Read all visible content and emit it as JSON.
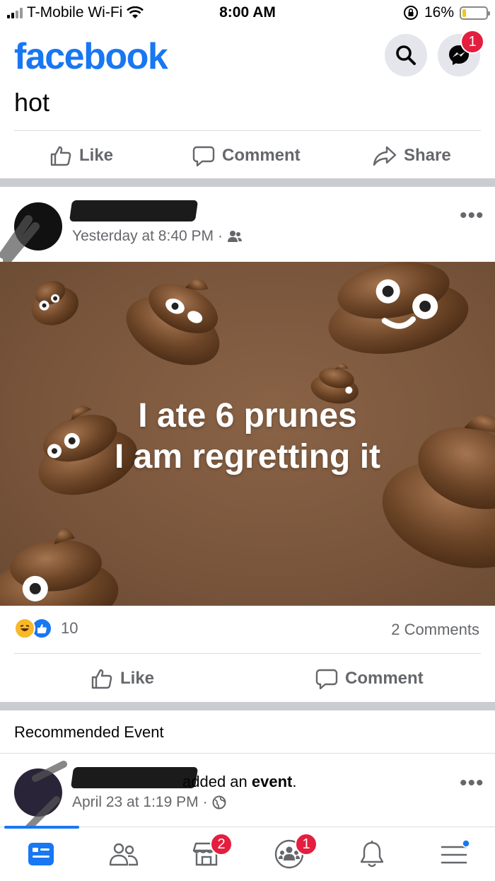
{
  "status_bar": {
    "carrier": "T-Mobile Wi-Fi",
    "time": "8:00 AM",
    "battery_percent": "16%",
    "battery_level": 0.16
  },
  "header": {
    "logo": "facebook",
    "messenger_badge": "1"
  },
  "post1": {
    "text": "hot",
    "actions": {
      "like": "Like",
      "comment": "Comment",
      "share": "Share"
    }
  },
  "post2": {
    "timestamp": "Yesterday at 8:40 PM",
    "audience_icon": "friends-icon",
    "image_caption": [
      "I ate 6 prunes",
      "I am regretting it"
    ],
    "reaction_count": "10",
    "comments_count": "2 Comments",
    "actions": {
      "like": "Like",
      "comment": "Comment"
    }
  },
  "recommended": {
    "section_label": "Recommended Event",
    "activity_suffix": "added an ",
    "activity_object": "event",
    "activity_end": ".",
    "timestamp": "April 23 at 1:19 PM",
    "audience_icon": "globe-icon"
  },
  "bottom_nav": {
    "marketplace_badge": "2",
    "groups_badge": "1"
  },
  "colors": {
    "brand": "#1877f2",
    "badge": "#e41e3f",
    "secondary_text": "#65676b",
    "separator": "#c9ccd1",
    "media_bg": "#7a563c"
  }
}
